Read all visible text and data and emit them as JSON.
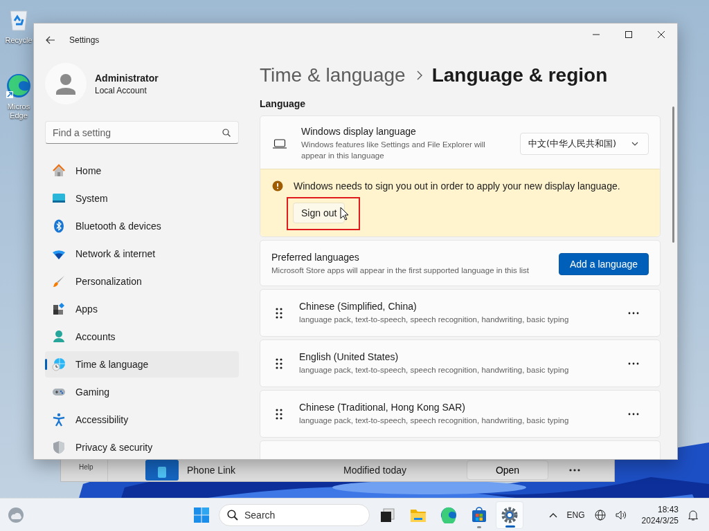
{
  "desktop_icons": [
    {
      "kind": "recycle",
      "label": "Recycle"
    },
    {
      "kind": "edge",
      "label": "Micros Edge"
    }
  ],
  "background_window": {
    "nav_label": "Help",
    "app_name": "Phone Link",
    "modified": "Modified today",
    "open_button": "Open"
  },
  "window": {
    "title": "Settings"
  },
  "account": {
    "name": "Administrator",
    "type": "Local Account"
  },
  "search": {
    "placeholder": "Find a setting"
  },
  "nav": [
    {
      "kind": "home",
      "label": "Home",
      "selected": false
    },
    {
      "kind": "system",
      "label": "System",
      "selected": false
    },
    {
      "kind": "bluetooth",
      "label": "Bluetooth & devices",
      "selected": false
    },
    {
      "kind": "network",
      "label": "Network & internet",
      "selected": false
    },
    {
      "kind": "personalization",
      "label": "Personalization",
      "selected": false
    },
    {
      "kind": "apps",
      "label": "Apps",
      "selected": false
    },
    {
      "kind": "accounts",
      "label": "Accounts",
      "selected": false
    },
    {
      "kind": "time",
      "label": "Time & language",
      "selected": true
    },
    {
      "kind": "gaming",
      "label": "Gaming",
      "selected": false
    },
    {
      "kind": "accessibility",
      "label": "Accessibility",
      "selected": false
    },
    {
      "kind": "privacy",
      "label": "Privacy & security",
      "selected": false
    }
  ],
  "breadcrumb": {
    "parent": "Time & language",
    "current": "Language & region"
  },
  "section_title": "Language",
  "display_language": {
    "title": "Windows display language",
    "description": "Windows features like Settings and File Explorer will appear in this language",
    "value": "中文(中华人民共和国)"
  },
  "notice": {
    "message": "Windows needs to sign you out in order to apply your new display language.",
    "button": "Sign out",
    "highlighted": true
  },
  "preferred": {
    "title": "Preferred languages",
    "description": "Microsoft Store apps will appear in the first supported language in this list",
    "button": "Add a language"
  },
  "languages": [
    {
      "name": "Chinese (Simplified, China)",
      "features": "language pack, text-to-speech, speech recognition, handwriting, basic typing"
    },
    {
      "name": "English (United States)",
      "features": "language pack, text-to-speech, speech recognition, handwriting, basic typing"
    },
    {
      "name": "Chinese (Traditional, Hong Kong SAR)",
      "features": "language pack, text-to-speech, speech recognition, handwriting, basic typing"
    }
  ],
  "taskbar": {
    "search_placeholder": "Search",
    "apps": [
      {
        "kind": "taskview",
        "running": false,
        "selected": false
      },
      {
        "kind": "explorer",
        "running": false,
        "selected": false
      },
      {
        "kind": "edge",
        "running": false,
        "selected": false
      },
      {
        "kind": "store",
        "running": true,
        "selected": false
      },
      {
        "kind": "settings",
        "running": true,
        "selected": true
      }
    ],
    "language": "ENG",
    "time": "18:43",
    "date": "2024/3/25"
  }
}
